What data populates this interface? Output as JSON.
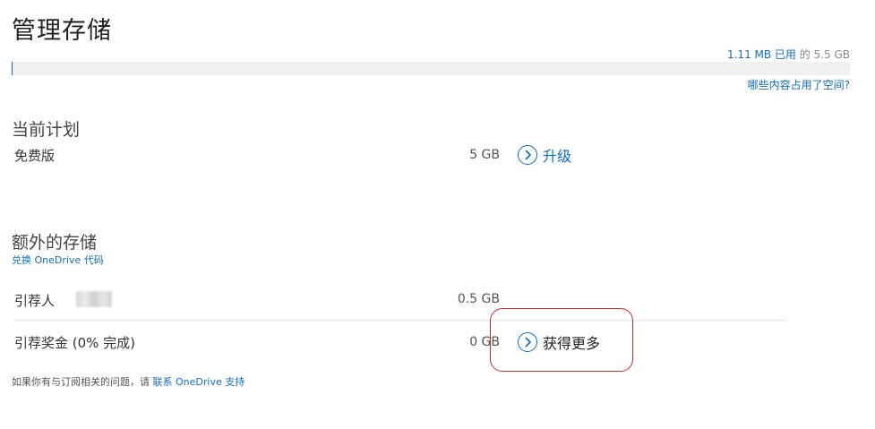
{
  "page": {
    "title": "管理存储"
  },
  "usage": {
    "used": "1.11 MB 已用",
    "of": " 的 ",
    "total": "5.5 GB",
    "used_fraction": 0.0002
  },
  "what_link": "哪些内容占用了空间?",
  "current_plan": {
    "heading": "当前计划",
    "name": "免费版",
    "size": "5 GB",
    "action": "升级"
  },
  "extra_storage": {
    "heading": "额外的存储",
    "redeem_link": "兑换 OneDrive 代码",
    "rows": [
      {
        "label": "引荐人",
        "size": "0.5 GB"
      },
      {
        "label": "引荐奖金 (0% 完成)",
        "size": "0 GB",
        "action": "获得更多"
      }
    ]
  },
  "footer": {
    "text": "如果你有与订阅相关的问题，请 ",
    "link": "联系 OneDrive 支持"
  },
  "colors": {
    "accent": "#0f6cbd",
    "highlight": "#d22a2a"
  }
}
